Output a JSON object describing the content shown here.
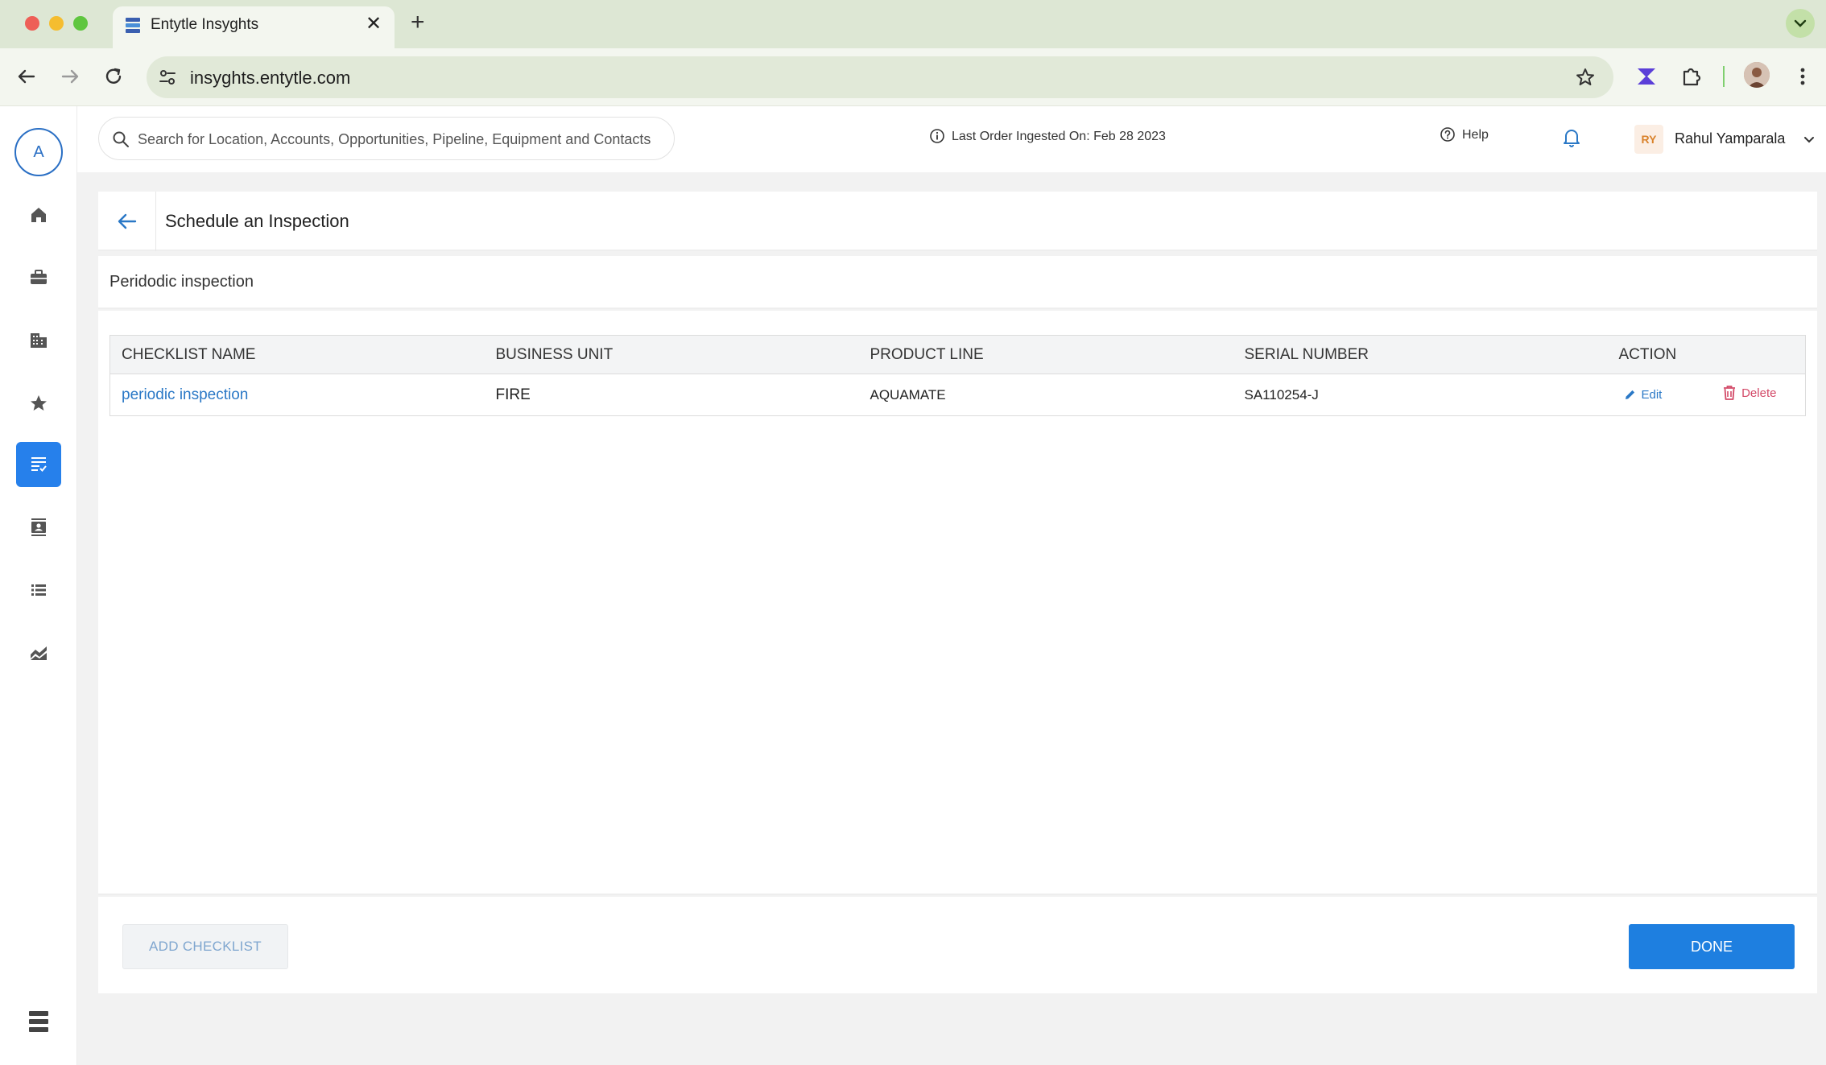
{
  "browser": {
    "tab_title": "Entytle Insyghts",
    "tab_close": "✕",
    "new_tab": "+",
    "url": "insyghts.entytle.com"
  },
  "sidebar": {
    "logo_letter": "A",
    "items": [
      {
        "name": "home",
        "icon": "home-icon",
        "active": false
      },
      {
        "name": "briefcase",
        "icon": "briefcase-icon",
        "active": false
      },
      {
        "name": "buildings",
        "icon": "building-icon",
        "active": false
      },
      {
        "name": "favorites",
        "icon": "star-icon",
        "active": false
      },
      {
        "name": "inspections",
        "icon": "checklist-icon",
        "active": true
      },
      {
        "name": "contacts",
        "icon": "contacts-icon",
        "active": false
      },
      {
        "name": "lists",
        "icon": "list-icon",
        "active": false
      },
      {
        "name": "analytics",
        "icon": "trend-icon",
        "active": false
      }
    ]
  },
  "header": {
    "search_placeholder": "Search for Location, Accounts, Opportunities, Pipeline, Equipment and Contacts",
    "last_order": "Last Order Ingested On: Feb 28 2023",
    "help": "Help",
    "user_initials": "RY",
    "user_name": "Rahul Yamparala"
  },
  "page": {
    "title": "Schedule an Inspection",
    "subtitle": "Peridodic inspection"
  },
  "table": {
    "headers": {
      "checklist_name": "CHECKLIST NAME",
      "business_unit": "BUSINESS UNIT",
      "product_line": "PRODUCT LINE",
      "serial_number": "SERIAL NUMBER",
      "action": "ACTION"
    },
    "rows": [
      {
        "checklist_name": "periodic inspection",
        "business_unit": "FIRE",
        "product_line": "AQUAMATE",
        "serial_number": "SA110254-J",
        "edit": "Edit",
        "delete": "Delete"
      }
    ]
  },
  "footer": {
    "add_checklist": "ADD CHECKLIST",
    "done": "DONE"
  },
  "colors": {
    "accent": "#1e7fe0",
    "link": "#2a78c6",
    "delete": "#d34a68",
    "chrome": "#dde7d4"
  }
}
